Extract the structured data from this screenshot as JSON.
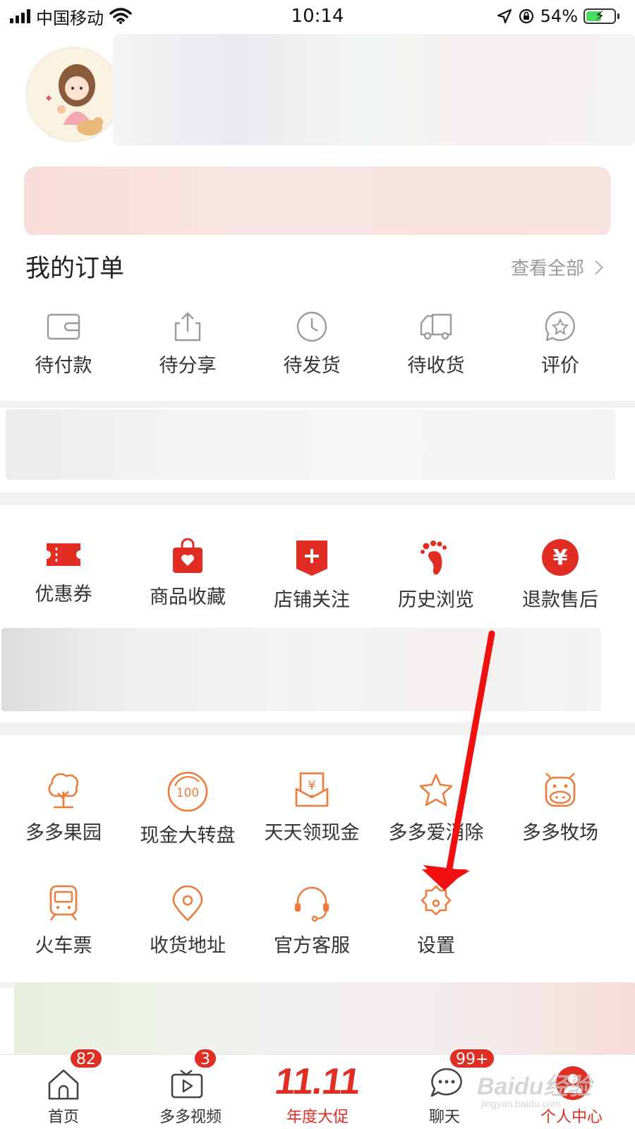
{
  "status_bar": {
    "carrier": "中国移动",
    "time": "10:14",
    "battery_percent": "54%",
    "battery_level": 0.54
  },
  "orders": {
    "title": "我的订单",
    "view_all": "查看全部",
    "items": [
      {
        "label": "待付款",
        "icon": "wallet-icon"
      },
      {
        "label": "待分享",
        "icon": "share-icon"
      },
      {
        "label": "待发货",
        "icon": "clock-icon"
      },
      {
        "label": "待收货",
        "icon": "truck-icon"
      },
      {
        "label": "评价",
        "icon": "review-star-icon"
      }
    ]
  },
  "quick_tools": {
    "items": [
      {
        "label": "优惠券",
        "icon": "coupon-icon"
      },
      {
        "label": "商品收藏",
        "icon": "favorite-bag-icon"
      },
      {
        "label": "店铺关注",
        "icon": "store-follow-icon"
      },
      {
        "label": "历史浏览",
        "icon": "footprint-icon"
      },
      {
        "label": "退款售后",
        "icon": "refund-yen-icon"
      }
    ]
  },
  "services": {
    "row1": [
      {
        "label": "多多果园",
        "icon": "tree-icon"
      },
      {
        "label": "现金大转盘",
        "icon": "wheel-100-icon"
      },
      {
        "label": "天天领现金",
        "icon": "cash-envelope-icon"
      },
      {
        "label": "多多爱消除",
        "icon": "star-icon"
      },
      {
        "label": "多多牧场",
        "icon": "cow-icon"
      }
    ],
    "row2": [
      {
        "label": "火车票",
        "icon": "train-icon"
      },
      {
        "label": "收货地址",
        "icon": "location-pin-icon"
      },
      {
        "label": "官方客服",
        "icon": "headset-icon"
      },
      {
        "label": "设置",
        "icon": "gear-icon"
      }
    ]
  },
  "tab_bar": {
    "tabs": [
      {
        "label": "首页",
        "badge": "82",
        "icon": "home-icon"
      },
      {
        "label": "多多视频",
        "badge": "3",
        "icon": "video-icon"
      },
      {
        "label": "年度大促",
        "promo": "11.11"
      },
      {
        "label": "聊天",
        "badge": "99+",
        "icon": "chat-icon"
      },
      {
        "label": "个人中心",
        "icon": "profile-icon",
        "active": true
      }
    ]
  },
  "colors": {
    "brand_red": "#e02e24",
    "service_orange": "#ef7b3a",
    "icon_gray": "#9a9a9a"
  },
  "watermark": {
    "main": "Baidu经验",
    "sub": "jingyan.baidu.com"
  }
}
